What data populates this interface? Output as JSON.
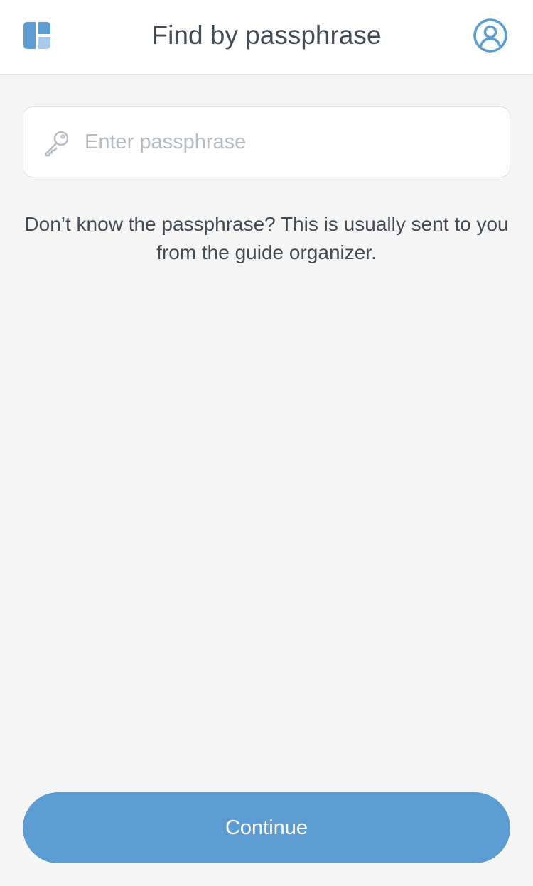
{
  "header": {
    "title": "Find by passphrase",
    "logo_icon": "layout-grid-icon",
    "profile_icon": "user-circle-icon"
  },
  "search": {
    "placeholder": "Enter passphrase",
    "value": "",
    "icon": "key-icon"
  },
  "hint": {
    "text": "Don’t know the passphrase? This is usually sent to you from the guide organizer."
  },
  "actions": {
    "continue_label": "Continue"
  },
  "colors": {
    "accent": "#5b9dd2",
    "accent_light": "#a9cbe9",
    "text": "#434c55",
    "placeholder": "#b7bcc1",
    "background": "#f5f5f6"
  }
}
